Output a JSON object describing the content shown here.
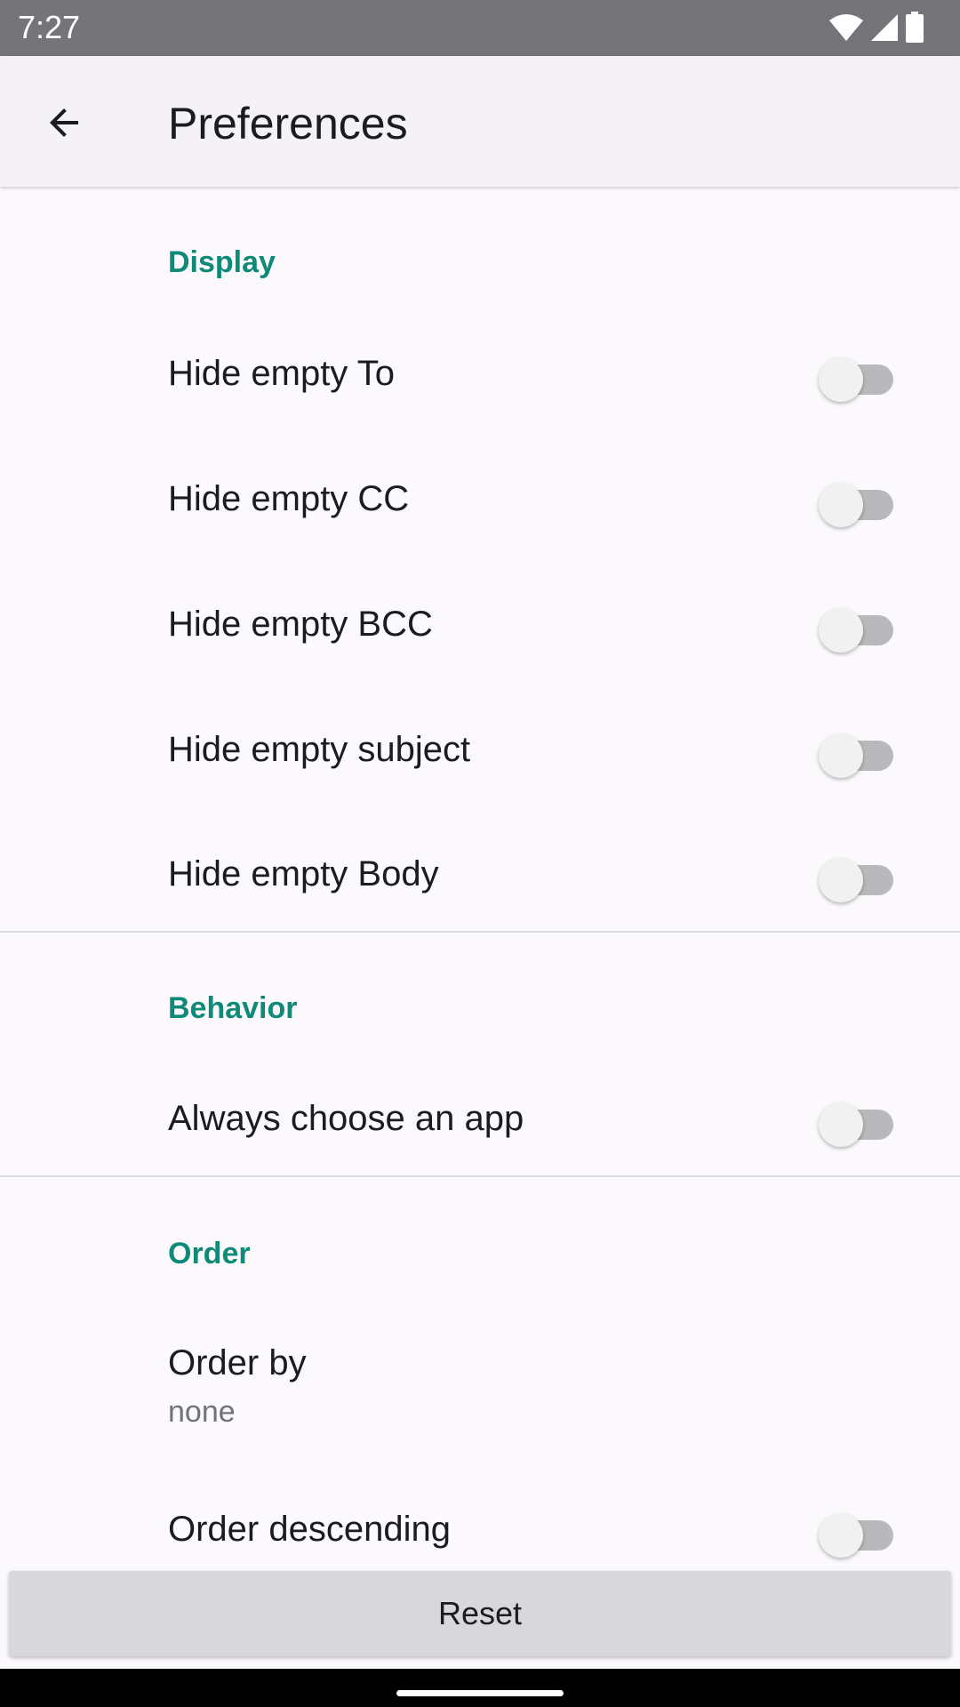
{
  "status_bar": {
    "time": "7:27",
    "icons": [
      "wifi-icon",
      "cellular-signal-icon",
      "battery-icon"
    ],
    "color": "#757478"
  },
  "app_bar": {
    "title": "Preferences",
    "back_icon": "arrow-back-icon"
  },
  "sections": {
    "display": {
      "header": "Display",
      "items": [
        {
          "title": "Hide empty To",
          "checked": false
        },
        {
          "title": "Hide empty CC",
          "checked": false
        },
        {
          "title": "Hide empty BCC",
          "checked": false
        },
        {
          "title": "Hide empty subject",
          "checked": false
        },
        {
          "title": "Hide empty Body",
          "checked": false
        }
      ]
    },
    "behavior": {
      "header": "Behavior",
      "items": [
        {
          "title": "Always choose an app",
          "checked": false
        }
      ]
    },
    "order": {
      "header": "Order",
      "order_by": {
        "title": "Order by",
        "summary": "none"
      },
      "order_descending": {
        "title": "Order descending",
        "checked": false
      }
    }
  },
  "footer": {
    "reset_label": "Reset"
  },
  "colors": {
    "accent": "#0f8a78",
    "background": "#fbf9fc",
    "app_bar": "#f4f2f5",
    "button": "#d8d8da"
  }
}
